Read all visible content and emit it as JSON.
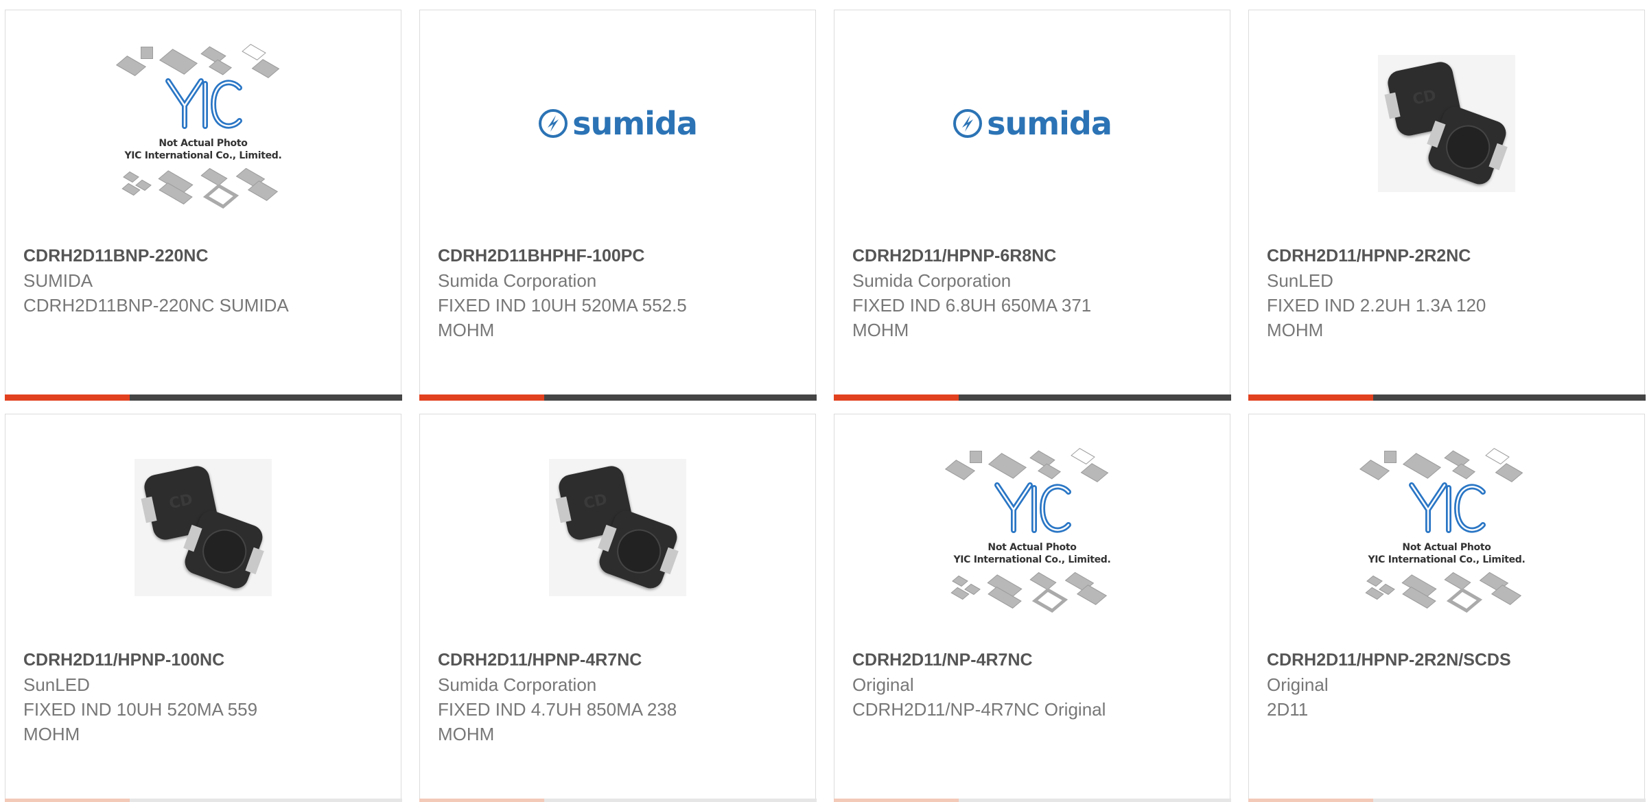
{
  "products": [
    {
      "part": "CDRH2D11BNP-220NC",
      "manufacturer": "SUMIDA",
      "desc_lines": [
        "CDRH2D11BNP-220NC SUMIDA"
      ],
      "image": "yic-placeholder"
    },
    {
      "part": "CDRH2D11BHPHF-100PC",
      "manufacturer": "Sumida Corporation",
      "desc_lines": [
        "FIXED IND 10UH 520MA 552.5",
        "MOHM"
      ],
      "image": "sumida-logo"
    },
    {
      "part": "CDRH2D11/HPNP-6R8NC",
      "manufacturer": "Sumida Corporation",
      "desc_lines": [
        "FIXED IND 6.8UH 650MA 371",
        "MOHM"
      ],
      "image": "sumida-logo"
    },
    {
      "part": "CDRH2D11/HPNP-2R2NC",
      "manufacturer": "SunLED",
      "desc_lines": [
        "FIXED IND 2.2UH 1.3A 120",
        "MOHM"
      ],
      "image": "inductor-photo"
    },
    {
      "part": "CDRH2D11/HPNP-100NC",
      "manufacturer": "SunLED",
      "desc_lines": [
        "FIXED IND 10UH 520MA 559",
        "MOHM"
      ],
      "image": "inductor-photo"
    },
    {
      "part": "CDRH2D11/HPNP-4R7NC",
      "manufacturer": "Sumida Corporation",
      "desc_lines": [
        "FIXED IND 4.7UH 850MA 238",
        "MOHM"
      ],
      "image": "inductor-photo"
    },
    {
      "part": "CDRH2D11/NP-4R7NC",
      "manufacturer": "Original",
      "desc_lines": [
        "CDRH2D11/NP-4R7NC Original"
      ],
      "image": "yic-placeholder"
    },
    {
      "part": "CDRH2D11/HPNP-2R2N/SCDS",
      "manufacturer": "Original",
      "desc_lines": [
        "2D11"
      ],
      "image": "yic-placeholder"
    }
  ],
  "placeholder": {
    "logo_text": "YIC",
    "line1": "Not Actual Photo",
    "line2": "YIC International Co., Limited."
  },
  "sumida_logo_text": "sumida",
  "inductor_marking": "CD",
  "colors": {
    "accent": "#e2411f",
    "bar_dark": "#454545",
    "text_bold": "#555555",
    "text_muted": "#777777",
    "brand_blue": "#2b73b5"
  }
}
